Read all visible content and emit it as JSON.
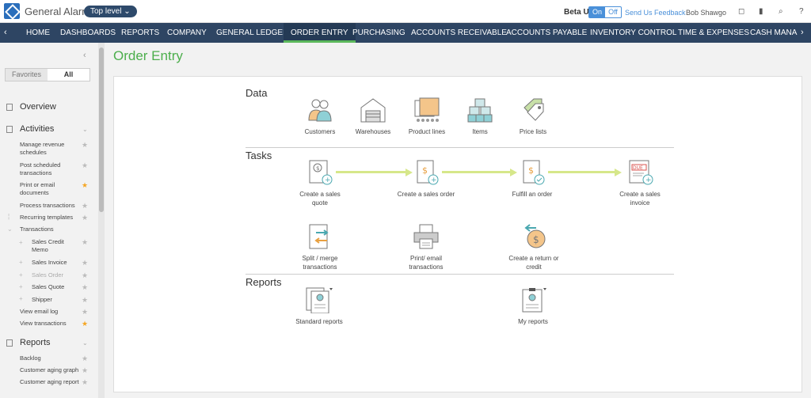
{
  "topbar": {
    "company": "General Alarm",
    "level": "Top level",
    "beta_label": "Beta UI",
    "toggle_on": "On",
    "toggle_off": "Off",
    "feedback": "Send Us Feedback",
    "user": "Bob Shawgo",
    "icons": [
      "chat-icon",
      "bookmark-icon",
      "search-icon",
      "help-icon"
    ]
  },
  "nav": {
    "items": [
      "HOME",
      "DASHBOARDS",
      "REPORTS",
      "COMPANY",
      "GENERAL LEDGER",
      "ORDER ENTRY",
      "PURCHASING",
      "ACCOUNTS RECEIVABLE",
      "ACCOUNTS PAYABLE",
      "INVENTORY CONTROL",
      "TIME & EXPENSES",
      "CASH MANA"
    ],
    "active": "ORDER ENTRY"
  },
  "sidebar": {
    "tab_favorites": "Favorites",
    "tab_all": "All",
    "overview": "Overview",
    "activities": "Activities",
    "items": [
      "Manage revenue schedules",
      "Post scheduled transactions",
      "Print or email documents",
      "Process transactions",
      "Recurring templates",
      "Transactions",
      "Sales Credit Memo",
      "Sales Invoice",
      "Sales Order",
      "Sales Quote",
      "Shipper",
      "View email log",
      "View transactions"
    ],
    "reports": "Reports",
    "report_items": [
      "Backlog",
      "Customer aging graph",
      "Customer aging report"
    ]
  },
  "main": {
    "title": "Order Entry",
    "data_heading": "Data",
    "data_tiles": [
      "Customers",
      "Warehouses",
      "Product lines",
      "Items",
      "Price lists"
    ],
    "tasks_heading": "Tasks",
    "task_tiles": [
      "Create a sales quote",
      "Create a sales order",
      "Fulfill an order",
      "Create a sales invoice",
      "Split / merge transactions",
      "Print/ email transactions",
      "Create a return or credit"
    ],
    "reports_heading": "Reports",
    "report_tiles": [
      "Standard reports",
      "My reports"
    ]
  },
  "colors": {
    "accent_green": "#4cae4c",
    "nav_bg": "#2e4563",
    "link_blue": "#4a90d9",
    "star_gold": "#f5a623",
    "flow_arrow": "#d6e78a"
  }
}
